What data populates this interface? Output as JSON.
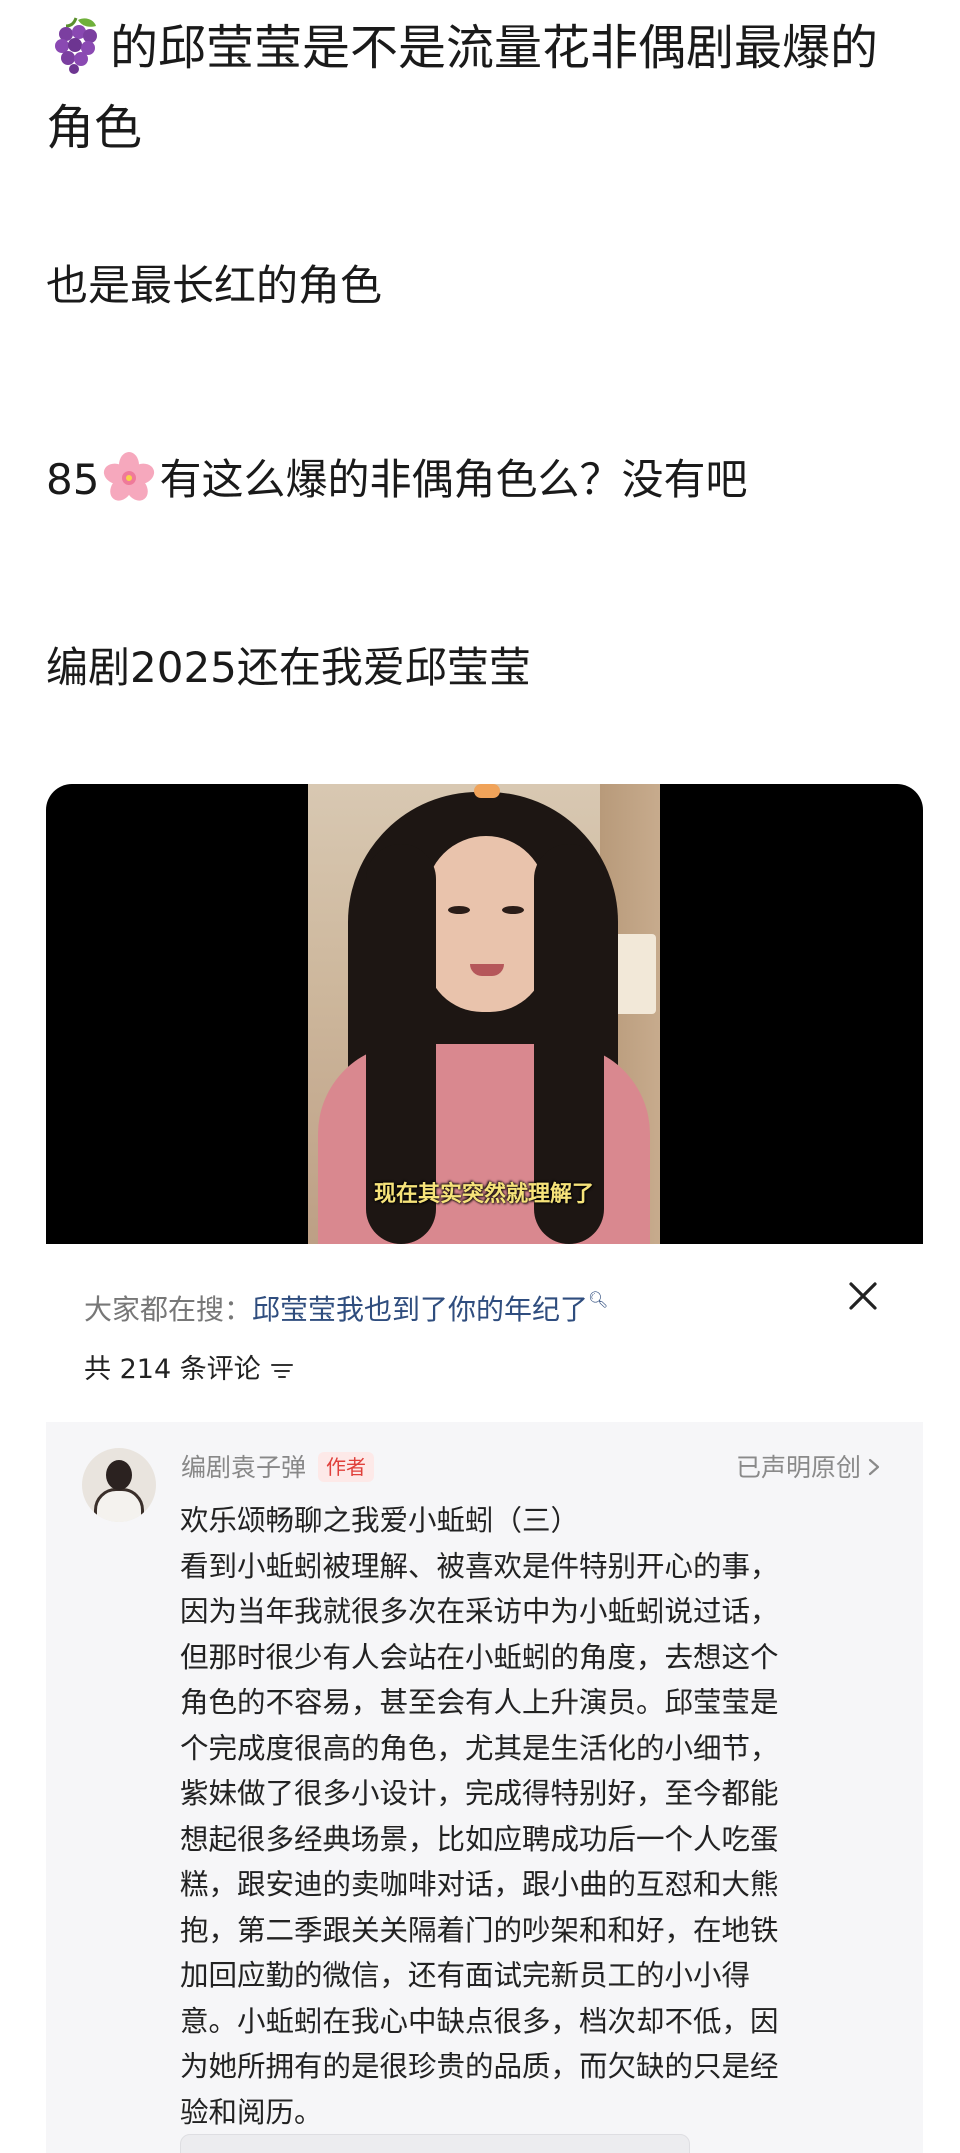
{
  "post": {
    "title": "的邱莹莹是不是流量花非偶剧最爆的角色",
    "title_emoji": "grape-emoji",
    "line1": "也是最长红的角色",
    "line2_prefix": "85",
    "line2_emoji": "cherry-blossom-emoji",
    "line2_suffix": "有这么爆的非偶角色么？没有吧",
    "line3": "编剧2025还在我爱邱莹莹"
  },
  "video": {
    "subtitle": "现在其实突然就理解了"
  },
  "comments_sheet": {
    "search_prefix": "大家都在搜：",
    "search_term": "邱莹莹我也到了你的年纪了",
    "close_icon": "close-icon",
    "count_label": "共 214 条评论",
    "sort_icon": "sort-icon"
  },
  "comment": {
    "author": "编剧袁子弹",
    "author_tag": "作者",
    "declaration": "已声明原创",
    "body": "欢乐颂畅聊之我爱小蚯蚓（三）\n看到小蚯蚓被理解、被喜欢是件特别开心的事，\n因为当年我就很多次在采访中为小蚯蚓说过话，\n但那时很少有人会站在小蚯蚓的角度，去想这个\n角色的不容易，甚至会有人上升演员。邱莹莹是\n个完成度很高的角色，尤其是生活化的小细节，\n紫妹做了很多小设计，完成得特别好，至今都能\n想起很多经典场景，比如应聘成功后一个人吃蛋\n糕，跟安迪的卖咖啡对话，跟小曲的互怼和大熊\n抱，第二季跟关关隔着门的吵架和和好，在地铁\n加回应勤的微信，还有面试完新员工的小小得\n意。小蚯蚓在我心中缺点很多，档次却不低，因\n为她所拥有的是很珍贵的品质，而欠缺的只是经\n验和阅历。"
  },
  "colors": {
    "accent_blue": "#2f4d7e",
    "author_tag_red": "#e0403b",
    "subtitle_yellow": "#f6e37a"
  }
}
